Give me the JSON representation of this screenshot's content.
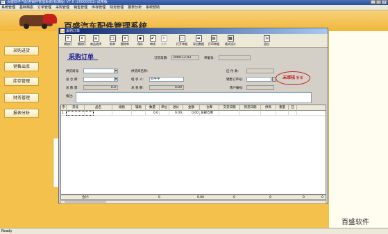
{
  "app": {
    "title": "百盛软件汽配进销存管理系统(标准版)  V7.0  (20000001)-试用版",
    "window_buttons": [
      "_",
      "□",
      "×"
    ]
  },
  "menubar": [
    "系统管理",
    "基础档案",
    "订单管理",
    "采购管理",
    "销售管理",
    "库存管理",
    "财务管理",
    "报表分析",
    "系统帮助"
  ],
  "banner": {
    "title": "百盛汽车配件管理系统"
  },
  "sidebar": [
    {
      "label": "采购进货"
    },
    {
      "label": "销售出库"
    },
    {
      "label": "库存管理"
    },
    {
      "label": "财务管理"
    },
    {
      "label": "报表分析"
    }
  ],
  "window": {
    "title": "采购订单",
    "toolbar": [
      {
        "label": "增加行",
        "icon": "add-row-icon",
        "glyph": "+",
        "disabled": false
      },
      {
        "label": "删除行",
        "icon": "delete-row-icon",
        "glyph": "×",
        "disabled": false
      },
      {
        "label": "商品选择",
        "icon": "product-select-icon",
        "glyph": "≡",
        "disabled": false
      },
      {
        "label": "新单",
        "icon": "new-doc-icon",
        "glyph": "□",
        "disabled": false
      },
      {
        "label": "删除单",
        "icon": "delete-doc-icon",
        "glyph": "×",
        "disabled": false
      },
      {
        "label": "保存",
        "icon": "save-icon",
        "glyph": "▪",
        "disabled": false
      },
      {
        "label": "审核",
        "icon": "approve-icon",
        "glyph": "✔",
        "disabled": false
      },
      {
        "label": "弃审",
        "icon": "unapprove-icon",
        "glyph": "✘",
        "disabled": true
      },
      {
        "label": "打开单据",
        "icon": "open-doc-icon",
        "glyph": "▭",
        "disabled": false
      },
      {
        "label": "导出数据",
        "icon": "export-icon",
        "glyph": "➜",
        "disabled": false
      },
      {
        "label": "打印单据",
        "icon": "print-icon",
        "glyph": "▤",
        "disabled": false
      },
      {
        "label": "格式设计",
        "icon": "format-design-icon",
        "glyph": "▦",
        "disabled": false
      },
      {
        "label": "退出",
        "icon": "exit-icon",
        "glyph": "⇲",
        "disabled": false
      }
    ]
  },
  "form": {
    "heading": "采购订单",
    "order_date_label": "订货日期:",
    "order_date": "2009-12-03",
    "doc_no_label": "单据号:",
    "doc_no": "",
    "supplier_no_label": "供货商号:",
    "supplier_no": "",
    "supplier_name_label": "供货商名称:",
    "supplier_name": "",
    "payable_label": "应 付 款:",
    "payable": "",
    "warehouse_label": "总 仓 库:",
    "warehouse": "",
    "handler_label": "经 手 人:",
    "handler": "何平平",
    "sales_order_label": "销售订单号:",
    "sales_order": "",
    "total_qty_label": "总 数 量:",
    "total_qty": "0.0",
    "total_amount_label": "总 金 额:",
    "total_amount": "0.00",
    "customer_no_label": "客户编号:",
    "customer_no": "",
    "memo_label": "备注:",
    "memo": "",
    "stamp_text": "未审核",
    "stamp_sub": "新单"
  },
  "grid": {
    "columns": [
      "序",
      "货号",
      "品名",
      "规格",
      "辅助",
      "数量",
      "单位",
      "进价",
      "金额",
      "仓库",
      "交货日期",
      "到货日期",
      "供商",
      "重量",
      "已"
    ],
    "rows": [
      [
        "1",
        "",
        "",
        "",
        "",
        "0.0",
        "",
        "0.00",
        "0.00",
        "总部仓库",
        "",
        "",
        "",
        "",
        ""
      ]
    ]
  },
  "totals": {
    "label": "合计:",
    "values": [
      "0",
      "0.00",
      "0",
      "0",
      "0",
      "0"
    ]
  },
  "status": {
    "text": "Ready"
  },
  "watermark": "百盛软件"
}
